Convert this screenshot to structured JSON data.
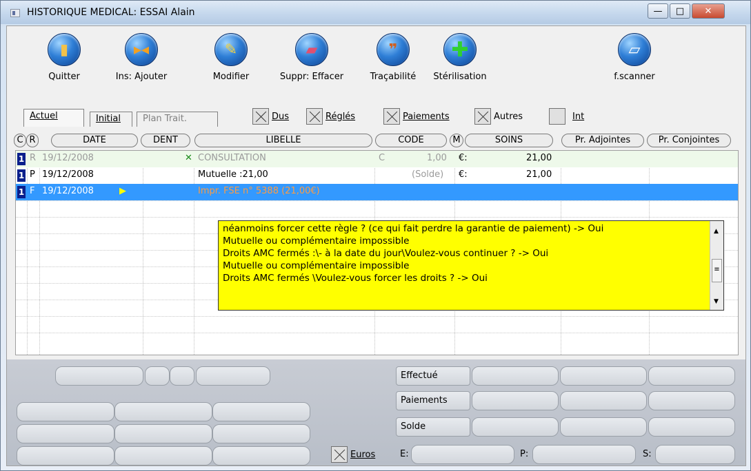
{
  "window": {
    "title": "HISTORIQUE MEDICAL: ESSAI Alain"
  },
  "toolbar": {
    "quit": "Quitter",
    "add": "Ins: Ajouter",
    "edit": "Modifier",
    "delete": "Suppr: Effacer",
    "trace": "Traçabilité",
    "steril": "Stérilisation",
    "scanner": "f.scanner"
  },
  "tabs": {
    "current": "Actuel",
    "initial": "Initial",
    "plan": "Plan Trait."
  },
  "filters": {
    "dus": "Dus",
    "regles": "Réglés",
    "paiements": "Paiements",
    "autres": "Autres",
    "int": "Int"
  },
  "columns": {
    "c": "C",
    "r": "R",
    "date": "DATE",
    "dent": "DENT",
    "libelle": "LIBELLE",
    "code": "CODE",
    "m": "M",
    "soins": "SOINS",
    "adjointes": "Pr. Adjointes",
    "conjointes": "Pr. Conjointes"
  },
  "rows": [
    {
      "c": "1",
      "r": "R",
      "date": "19/12/2008",
      "dent": "✕",
      "libelle": "CONSULTATION",
      "code": "C",
      "coef": "1,00",
      "m": "€:",
      "soins": "21,00"
    },
    {
      "c": "1",
      "r": "P",
      "date": "19/12/2008",
      "dent": "",
      "libelle": "Mutuelle :21,00",
      "code": "(Solde)",
      "coef": "",
      "m": "€:",
      "soins": "21,00"
    },
    {
      "c": "1",
      "r": "F",
      "date": "19/12/2008",
      "dent": "",
      "libelle": "Impr. FSE n° 5388 (21,00€)",
      "code": "",
      "coef": "",
      "m": "",
      "soins": ""
    }
  ],
  "note": {
    "lines": [
      "néanmoins forcer cette règle ? (ce qui fait perdre la garantie de paiement) -> Oui",
      "Mutuelle ou complémentaire impossible",
      "Droits AMC fermés :\\- à la date du jour\\Voulez-vous continuer ? -> Oui",
      "Mutuelle ou complémentaire impossible",
      "Droits AMC fermés \\Voulez-vous forcer les droits ? -> Oui"
    ]
  },
  "summary": {
    "effectue": "Effectué",
    "paiements": "Paiements",
    "solde": "Solde",
    "euros": "Euros",
    "e": "E:",
    "p": "P:",
    "s": "S:"
  },
  "colors": {
    "selection": "#3399ff",
    "note": "#ffff00",
    "badge": "#0a1f8c",
    "done_row": "#eef9ea"
  }
}
